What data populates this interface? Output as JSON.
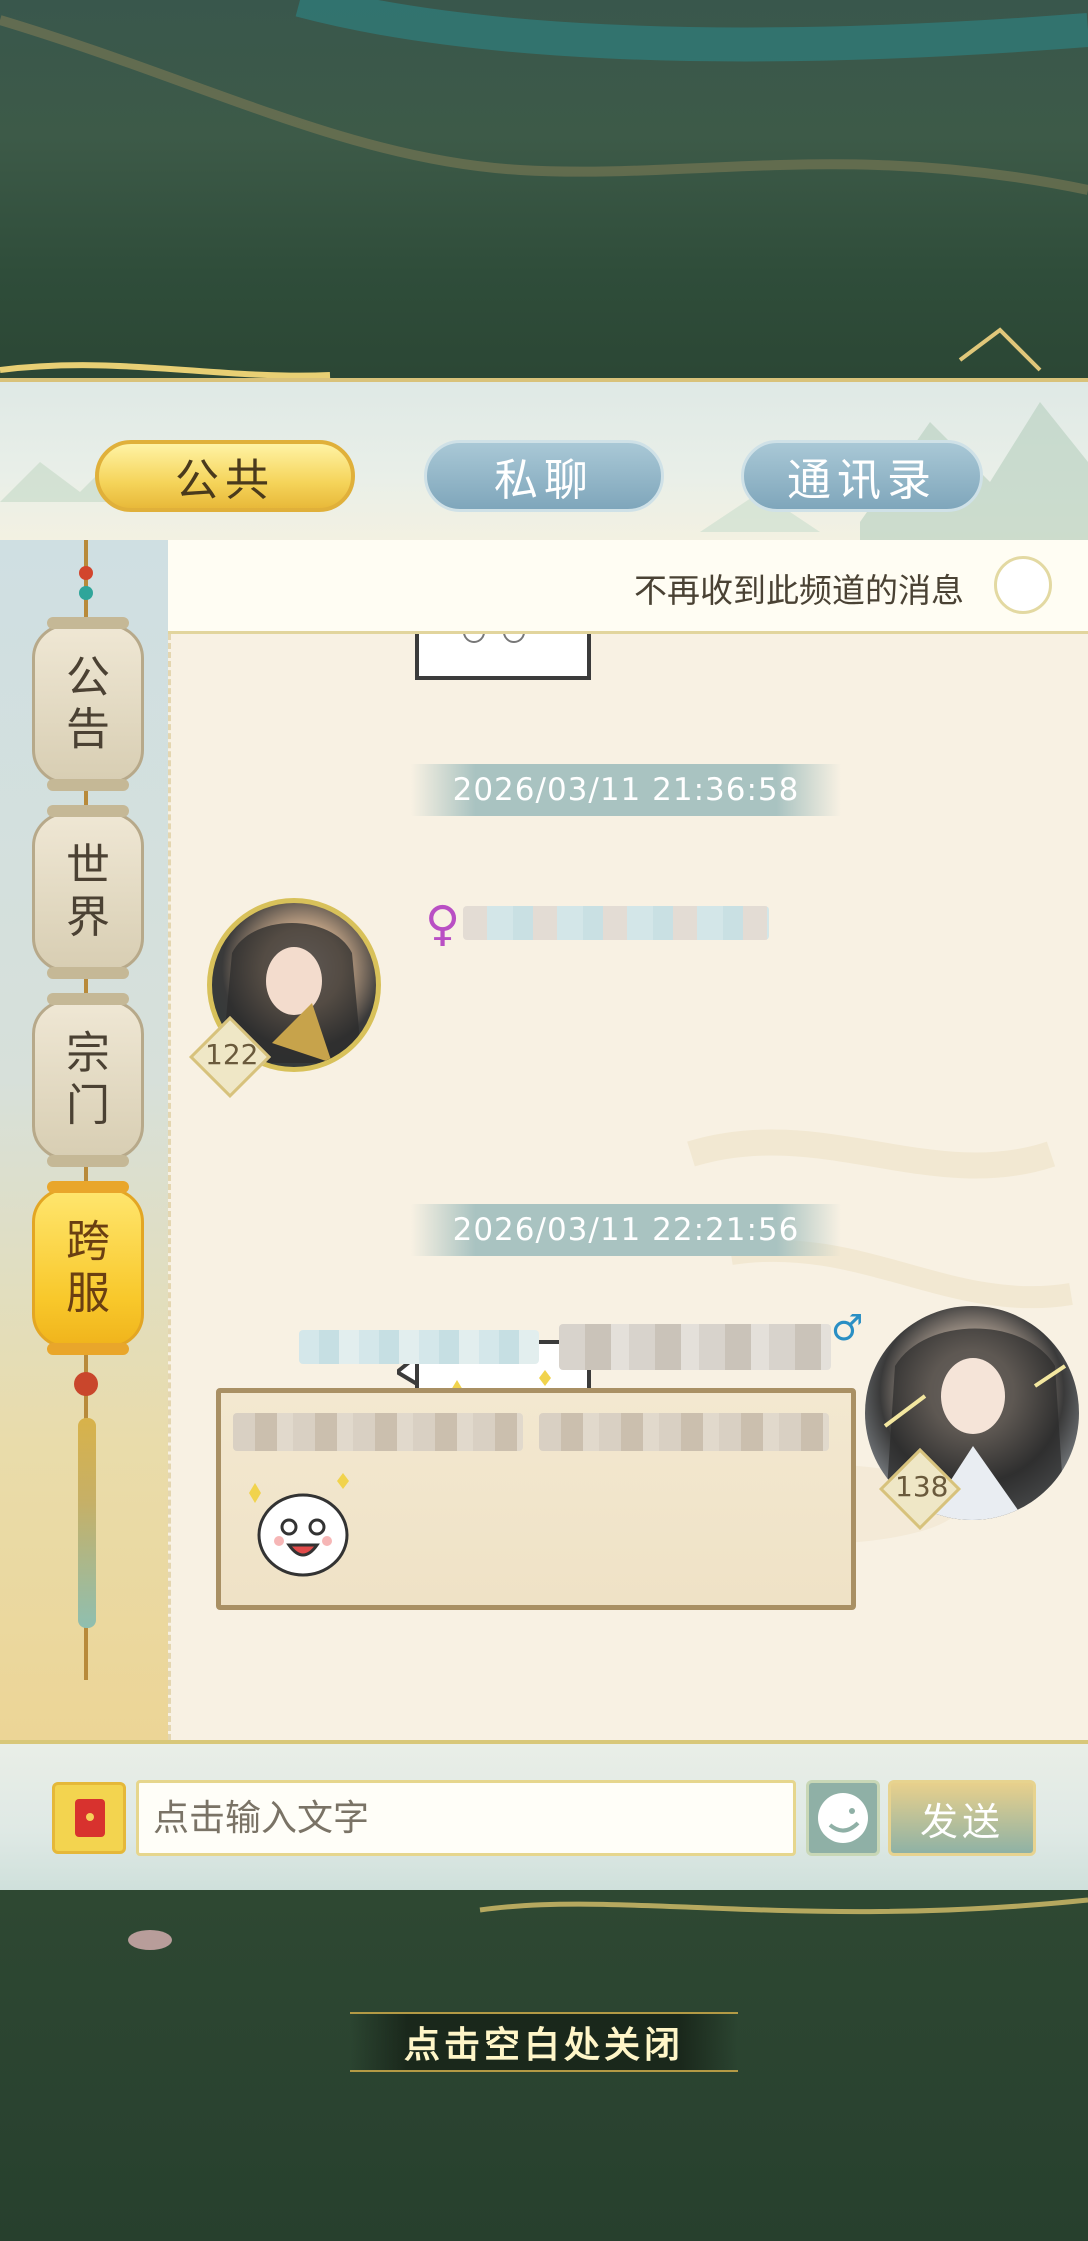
{
  "tabs": [
    {
      "label": "公共",
      "active": true
    },
    {
      "label": "私聊",
      "active": false
    },
    {
      "label": "通讯录",
      "active": false
    }
  ],
  "channels": [
    {
      "label_top": "公",
      "label_bottom": "告",
      "active": false
    },
    {
      "label_top": "世",
      "label_bottom": "界",
      "active": false
    },
    {
      "label_top": "宗",
      "label_bottom": "门",
      "active": false
    },
    {
      "label_top": "跨",
      "label_bottom": "服",
      "active": true
    }
  ],
  "notice": {
    "text": "不再收到此频道的消息",
    "toggle_checked": false
  },
  "messages": [
    {
      "timestamp": "2026/03/11  21:36:58",
      "direction": "received",
      "gender": "♀",
      "level": "122",
      "content": "sticker"
    },
    {
      "timestamp": "2026/03/11  22:21:56",
      "direction": "sent",
      "gender": "♂",
      "level": "138",
      "content": "sticker"
    }
  ],
  "input": {
    "placeholder": "点击输入文字",
    "value": "",
    "send_label": "发送"
  },
  "close_hint": "点击空白处关闭",
  "colors": {
    "accent_gold": "#f5d45a",
    "tab_inactive": "#7fa6bb",
    "female": "#b94fc4",
    "male": "#2a8fc4"
  }
}
